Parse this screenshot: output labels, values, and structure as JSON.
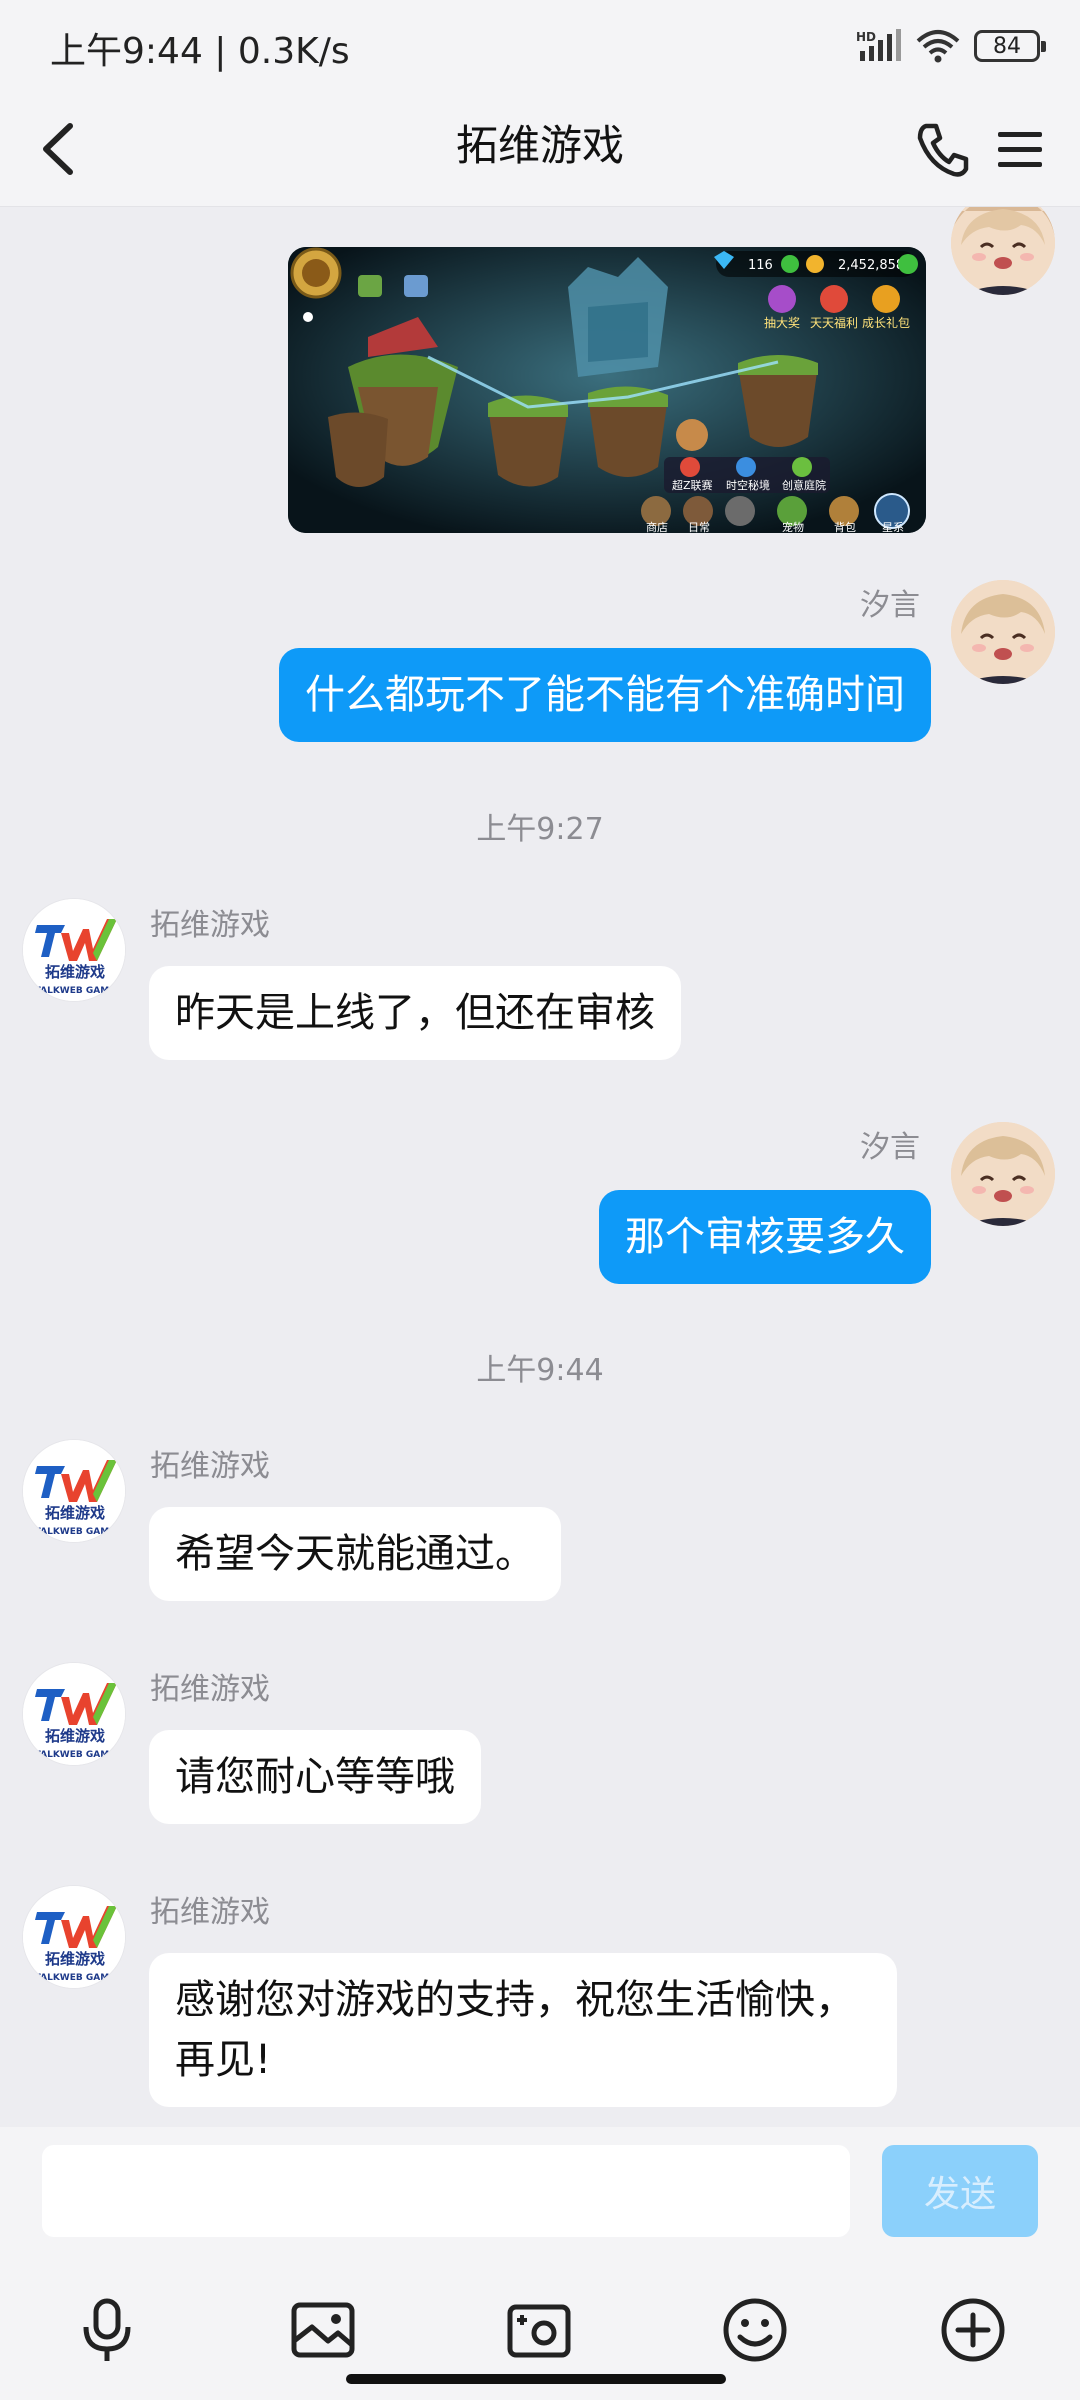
{
  "status_bar": {
    "time": "上午9:44 | 0.3K/s",
    "network": "HD",
    "battery": "84"
  },
  "nav": {
    "title": "拓维游戏",
    "back_icon": "chevron-left-icon",
    "phone_icon": "phone-icon",
    "menu_icon": "menu-icon"
  },
  "game_image": {
    "gem_count": "116",
    "coin_count": "2,452,858",
    "labels": [
      "抽大奖",
      "天天福利",
      "成长礼包",
      "超Z联赛",
      "时空秘境",
      "创意庭院",
      "商店",
      "日常",
      "宠物",
      "背包",
      "星系"
    ]
  },
  "users": {
    "self": "汐言",
    "agent": "拓维游戏"
  },
  "timestamps": [
    "上午9:27",
    "上午9:44"
  ],
  "messages": [
    {
      "from": "self",
      "text": "什么都玩不了能不能有个准确时间"
    },
    {
      "from": "agent",
      "text": "昨天是上线了，但还在审核"
    },
    {
      "from": "self",
      "text": "那个审核要多久"
    },
    {
      "from": "agent",
      "text": "希望今天就能通过。"
    },
    {
      "from": "agent",
      "text": "请您耐心等等哦"
    },
    {
      "from": "agent",
      "text": "感谢您对游戏的支持，祝您生活愉快，再见!"
    }
  ],
  "logo": {
    "letters": "TW",
    "name": "拓维游戏",
    "sub": "TALKWEB GAME"
  },
  "input": {
    "value": "",
    "send_label": "发送"
  },
  "toolbar": [
    "microphone-icon",
    "image-icon",
    "camera-icon",
    "emoji-icon",
    "plus-icon"
  ],
  "colors": {
    "outgoing_bubble": "#0e9af8",
    "send_button": "#8bd0fb",
    "background": "#ededf1"
  }
}
